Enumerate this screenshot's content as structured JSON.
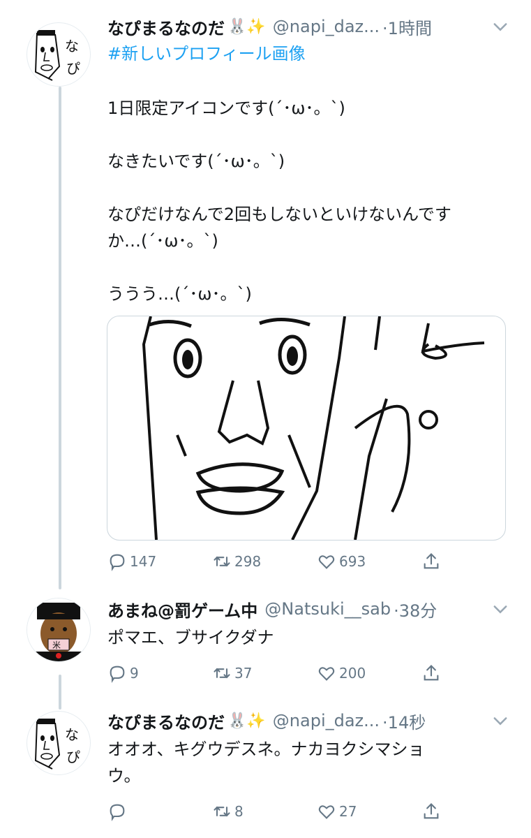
{
  "tweets": [
    {
      "name": "なぴまるなのだ",
      "emoji": "🐰✨",
      "handle": "@napi_daz...",
      "time": "·1時間",
      "hashtag": "#新しいプロフィール画像",
      "text": "1日限定アイコンです(´･ω･。`)\n\nなきたいです(´･ω･。`)\n\nなぴだけなんで2回もしないといけないんです\nか…(´･ω･。`)\n\nううう…(´･ω･。`)",
      "reply_count": "147",
      "retweet_count": "298",
      "like_count": "693"
    },
    {
      "name": "あまね@罰ゲーム中",
      "handle": "@Natsuki__sab",
      "time": "·38分",
      "text": "ポマエ、ブサイクダナ",
      "reply_count": "9",
      "retweet_count": "37",
      "like_count": "200"
    },
    {
      "name": "なぴまるなのだ",
      "emoji": "🐰✨",
      "handle": "@napi_daz...",
      "time": "·14秒",
      "text": "オオオ、キグウデスネ。ナカヨクシマショ\nウ。",
      "reply_count": "",
      "retweet_count": "8",
      "like_count": "27"
    }
  ],
  "icons": {
    "reply": "reply-icon",
    "retweet": "retweet-icon",
    "like": "heart-icon",
    "share": "share-icon",
    "caret": "chevron-down-icon"
  },
  "colors": {
    "text": "#14171a",
    "secondary": "#657786",
    "link": "#1da1f2",
    "thread_line": "#ccd6dd"
  }
}
